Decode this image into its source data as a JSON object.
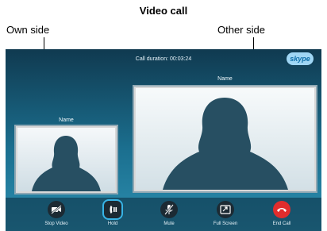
{
  "figure": {
    "title": "Video call"
  },
  "callouts": {
    "own": "Own side",
    "other": "Other side"
  },
  "call": {
    "duration": "Call duration: 00:03:24",
    "logo": "skype",
    "own_name": "Name",
    "other_name": "Name"
  },
  "toolbar": {
    "stop_video": "Stop Video",
    "hold": "Hold",
    "mute": "Mute",
    "full_screen": "Full Screen",
    "end_call": "End Call"
  },
  "colors": {
    "accent": "#37b4e6",
    "end_call": "#e12d2d",
    "background": "#1b6f8f"
  },
  "icons": [
    "video-off-icon",
    "hold-icon",
    "mute-icon",
    "full-screen-icon",
    "end-call-icon"
  ]
}
